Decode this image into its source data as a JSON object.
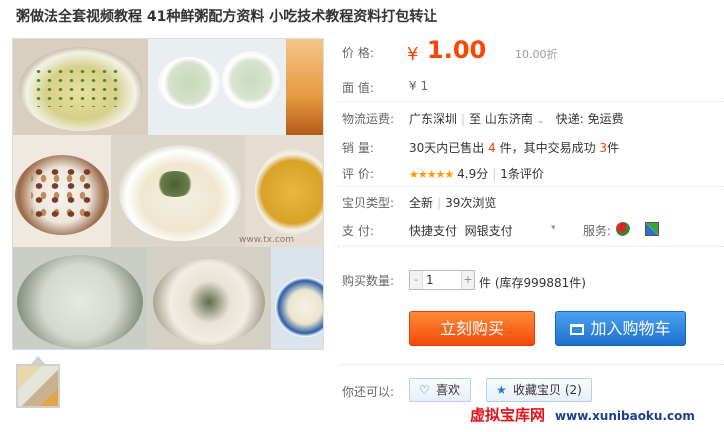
{
  "title": "粥做法全套视频教程 41种鲜粥配方资料 小吃技术教程资料打包转让",
  "gallery": {
    "watermark": "www.tx.com"
  },
  "price": {
    "label": "价    格:",
    "symbol": "¥",
    "value": "1.00",
    "discount": "10.00折"
  },
  "face_value": {
    "label": "面    值:",
    "value": "¥ 1"
  },
  "shipping": {
    "label": "物流运费:",
    "from": "广东深圳",
    "to_word": "至",
    "to": "山东济南",
    "fee": "快递: 免运费"
  },
  "sales": {
    "label": "销    量:",
    "prefix": "30天内已售出",
    "sold": "4",
    "mid": "件，其中交易成功",
    "success": "3",
    "suffix": "件"
  },
  "rating": {
    "label": "评    价:",
    "stars": "★★★★★",
    "score": "4.9分",
    "reviews": "1条评价"
  },
  "type": {
    "label": "宝贝类型:",
    "value": "全新",
    "views": "39次浏览"
  },
  "payment": {
    "label": "支    付:",
    "methods": [
      "快捷支付",
      "网银支付"
    ],
    "service_label": "服务:"
  },
  "quantity": {
    "label": "购买数量:",
    "value": "1",
    "minus": "-",
    "plus": "+",
    "stock": "件 (库存999881件)"
  },
  "buttons": {
    "buy": "立刻购买",
    "cart": "加入购物车"
  },
  "share": {
    "label": "你还可以:",
    "like": "喜欢",
    "favorite": "收藏宝贝 (2)"
  },
  "footer": {
    "site_name": "虚拟宝库网",
    "url": "www.xunibaoku.com"
  },
  "colors": {
    "accent": "#ff4400",
    "buy_button": "#f24b0b",
    "cart_button": "#1e6fcf",
    "watermark_red": "#e0131b"
  }
}
